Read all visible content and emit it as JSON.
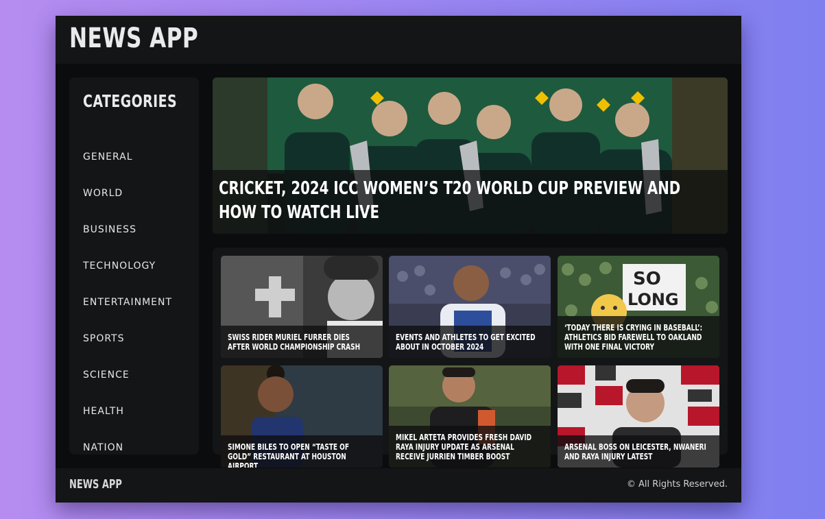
{
  "app": {
    "title": "NEWS APP"
  },
  "sidebar": {
    "title": "CATEGORIES",
    "items": [
      {
        "label": "GENERAL"
      },
      {
        "label": "WORLD"
      },
      {
        "label": "BUSINESS"
      },
      {
        "label": "TECHNOLOGY"
      },
      {
        "label": "ENTERTAINMENT"
      },
      {
        "label": "SPORTS"
      },
      {
        "label": "SCIENCE"
      },
      {
        "label": "HEALTH"
      },
      {
        "label": "NATION"
      }
    ]
  },
  "hero": {
    "title": "CRICKET, 2024 ICC WOMEN’S T20 WORLD CUP PREVIEW AND HOW TO WATCH LIVE"
  },
  "articles": [
    {
      "title": "SWISS RIDER MURIEL FURRER DIES AFTER WORLD CHAMPIONSHIP CRASH"
    },
    {
      "title": "EVENTS AND ATHLETES TO GET EXCITED ABOUT IN OCTOBER 2024"
    },
    {
      "title": "‘TODAY THERE IS CRYING IN BASEBALL’: ATHLETICS BID FAREWELL TO OAKLAND WITH ONE FINAL VICTORY"
    },
    {
      "title": "SIMONE BILES TO OPEN “TASTE OF GOLD” RESTAURANT AT HOUSTON AIRPORT"
    },
    {
      "title": "MIKEL ARTETA PROVIDES FRESH DAVID RAYA INJURY UPDATE AS ARSENAL RECEIVE JURRIEN TIMBER BOOST"
    },
    {
      "title": "ARSENAL BOSS ON LEICESTER, NWANERI AND RAYA INJURY LATEST"
    }
  ],
  "images": {
    "sign_text_1": "SO",
    "sign_text_2": "LONG"
  },
  "footer": {
    "brand": "NEWS APP",
    "copyright": "© All Rights Reserved."
  },
  "colors": {
    "background_left": "#b68cf0",
    "background_right": "#7f7ff0",
    "panel": "#141516",
    "window": "#0b0c0d",
    "text": "#e9eaec"
  }
}
